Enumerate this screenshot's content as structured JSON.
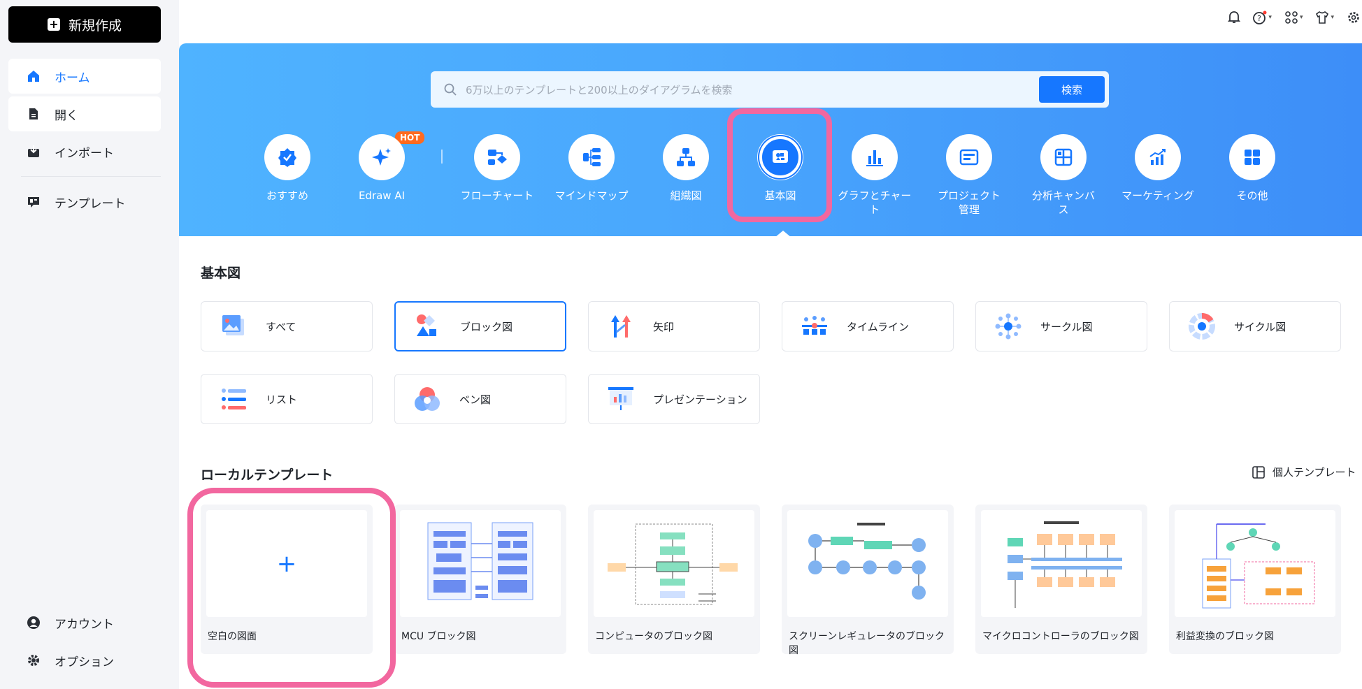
{
  "sidebar": {
    "new_button": "新規作成",
    "items": [
      {
        "label": "ホーム"
      },
      {
        "label": "開く"
      },
      {
        "label": "インポート"
      },
      {
        "label": "テンプレート"
      }
    ],
    "bottom": [
      {
        "label": "アカウント"
      },
      {
        "label": "オプション"
      }
    ]
  },
  "search": {
    "placeholder": "6万以上のテンプレートと200以上のダイアグラムを検索",
    "button": "検索"
  },
  "categories": [
    {
      "label": "おすすめ"
    },
    {
      "label": "Edraw AI",
      "badge": "HOT"
    },
    {
      "label": "フローチャート"
    },
    {
      "label": "マインドマップ"
    },
    {
      "label": "組織図"
    },
    {
      "label": "基本図",
      "selected": true
    },
    {
      "label": "グラフとチャー",
      "label2": "ト"
    },
    {
      "label": "プロジェクト",
      "label2": "管理"
    },
    {
      "label": "分析キャンバ",
      "label2": "ス"
    },
    {
      "label": "マーケティング"
    },
    {
      "label": "その他"
    }
  ],
  "basic": {
    "title": "基本図",
    "cards": [
      {
        "label": "すべて"
      },
      {
        "label": "ブロック図",
        "selected": true
      },
      {
        "label": "矢印"
      },
      {
        "label": "タイムライン"
      },
      {
        "label": "サークル図"
      },
      {
        "label": "サイクル図"
      },
      {
        "label": "リスト"
      },
      {
        "label": "ベン図"
      },
      {
        "label": "プレゼンテーション"
      }
    ]
  },
  "local": {
    "title": "ローカルテンプレート",
    "personal": "個人テンプレート",
    "templates": [
      {
        "label": "空白の図面"
      },
      {
        "label": "MCU ブロック図"
      },
      {
        "label": "コンピュータのブロック図"
      },
      {
        "label": "スクリーンレギュレータのブロック図"
      },
      {
        "label": "マイクロコントローラのブロック図"
      },
      {
        "label": "利益変換のブロック図"
      }
    ]
  },
  "colors": {
    "accent": "#1677ff",
    "highlight": "#f2679f",
    "banner": "#4aa8fd"
  }
}
